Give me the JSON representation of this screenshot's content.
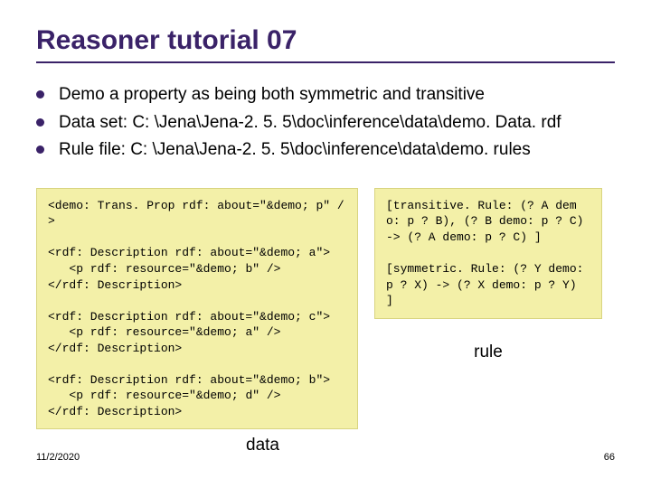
{
  "title": "Reasoner tutorial 07",
  "bullets": [
    "Demo a property as being both symmetric and transitive",
    "Data set: C: \\Jena\\Jena-2. 5. 5\\doc\\inference\\data\\demo. Data. rdf",
    "Rule file: C: \\Jena\\Jena-2. 5. 5\\doc\\inference\\data\\demo. rules"
  ],
  "leftCode": "<demo: Trans. Prop rdf: about=\"&demo; p\" />\n\n<rdf: Description rdf: about=\"&demo; a\">\n   <p rdf: resource=\"&demo; b\" />\n</rdf: Description>\n\n<rdf: Description rdf: about=\"&demo; c\">\n   <p rdf: resource=\"&demo; a\" />\n</rdf: Description>\n\n<rdf: Description rdf: about=\"&demo; b\">\n   <p rdf: resource=\"&demo; d\" />\n</rdf: Description>",
  "rightCode": "[transitive. Rule: (? A demo: p ? B), (? B demo: p ? C) -> (? A demo: p ? C) ]\n\n[symmetric. Rule: (? Y demo: p ? X) -> (? X demo: p ? Y) ]",
  "labels": {
    "rule": "rule",
    "data": "data"
  },
  "footer": {
    "date": "11/2/2020",
    "page": "66"
  }
}
